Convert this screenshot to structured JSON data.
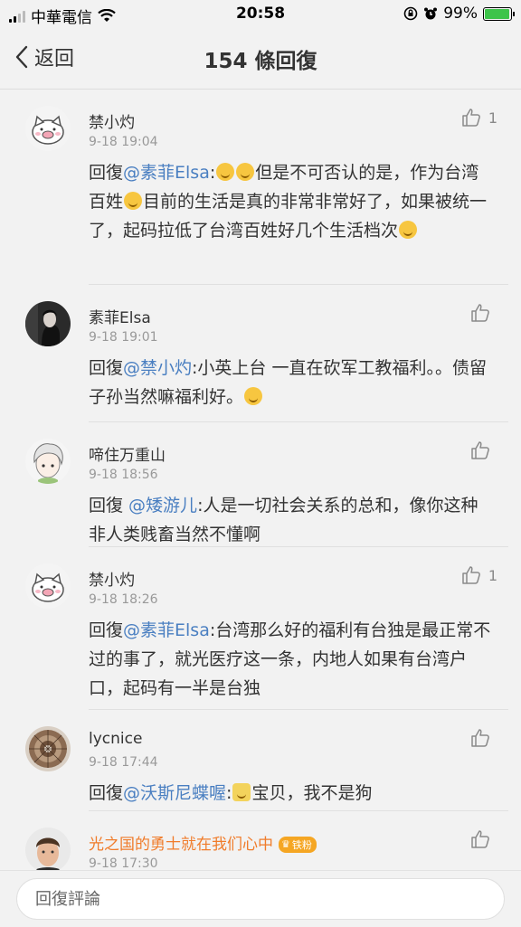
{
  "status_bar": {
    "carrier": "中華電信",
    "time": "20:58",
    "battery": "99%",
    "battery_level": 0.99
  },
  "nav": {
    "back_label": "返回",
    "title": "154 條回復"
  },
  "comments": [
    {
      "user": "禁小灼",
      "time": "9-18 19:04",
      "likes": "1",
      "prefix": "回復",
      "mention": "@素菲Elsa",
      "text_a": ":",
      "text_b": "但是不可否认的是，作为台湾百姓",
      "text_c": "目前的生活是真的非常非常好了，如果被统一了，起码拉低了台湾百姓好几个生活档次"
    },
    {
      "user": "素菲Elsa",
      "time": "9-18 19:01",
      "likes": "",
      "prefix": "回復",
      "mention": "@禁小灼",
      "text_a": ":小英上台 一直在砍军工教福利。。债留子孙当然嘛福利好。"
    },
    {
      "user": "啼住万重山",
      "time": "9-18 18:56",
      "likes": "",
      "prefix": "回復 ",
      "mention": "@矮游儿",
      "text_a": ":人是一切社会关系的总和，像你这种非人类贱畜当然不懂啊"
    },
    {
      "user": "禁小灼",
      "time": "9-18 18:26",
      "likes": "1",
      "prefix": "回復",
      "mention": "@素菲Elsa",
      "text_a": ":台湾那么好的福利有台独是最正常不过的事了，就光医疗这一条，内地人如果有台湾户口，起码有一半是台独"
    },
    {
      "user": "lycnice",
      "time": "9-18 17:44",
      "likes": "",
      "prefix": "回復",
      "mention": "@沃斯尼蝶喔",
      "text_a": ":",
      "text_b": "宝贝，我不是狗"
    },
    {
      "user": "光之国的勇士就在我们心中",
      "badge": "铁粉",
      "time": "9-18 17:30",
      "likes": ""
    }
  ],
  "reply": {
    "placeholder": "回復評論"
  },
  "colors": {
    "mention": "#4a7fc1",
    "highlight_user": "#f07c2b",
    "badge": "#f5a623"
  }
}
